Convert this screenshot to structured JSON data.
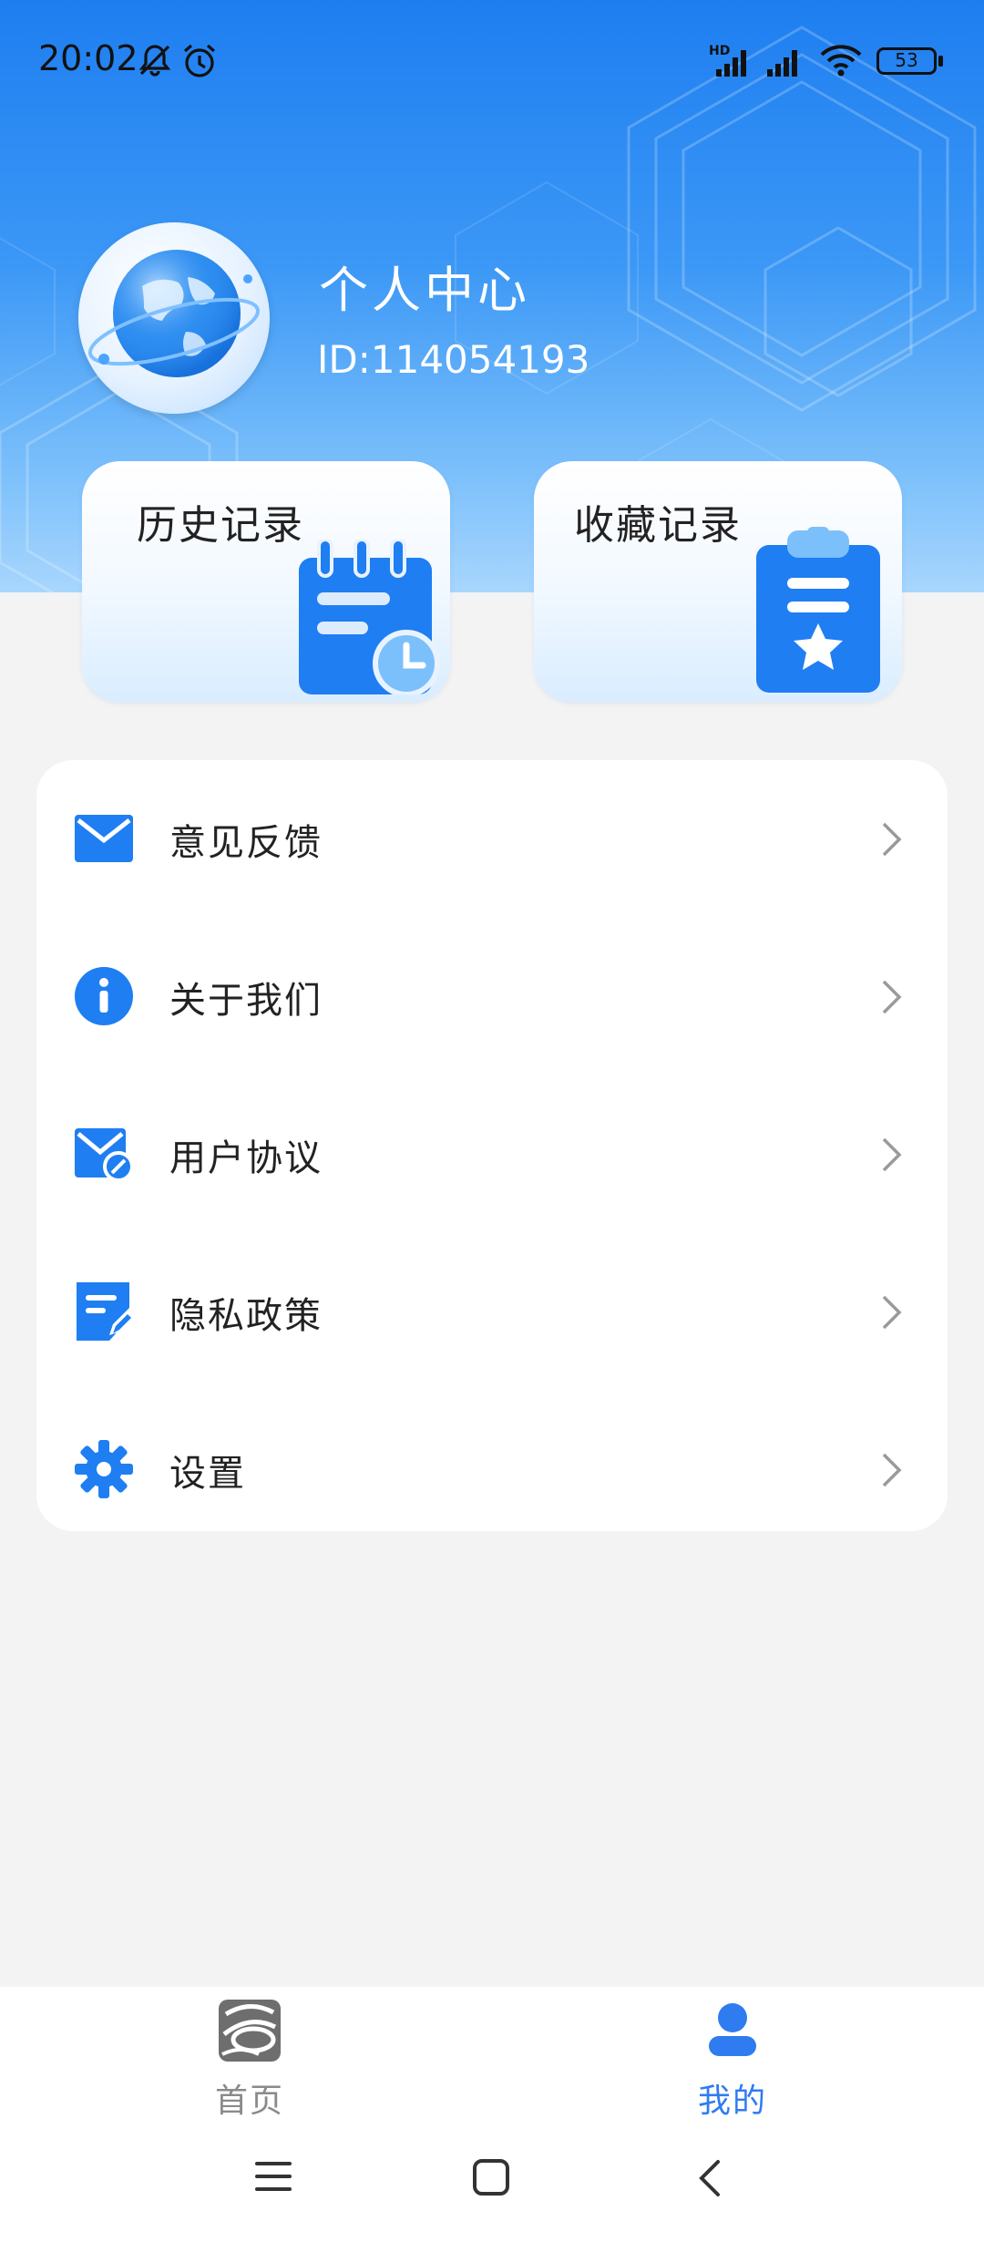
{
  "status_bar": {
    "time": "20:02",
    "battery": "53",
    "network_label": "HD"
  },
  "profile": {
    "name": "个人中心",
    "id": "ID:114054193"
  },
  "quick_cards": {
    "history": {
      "label": "历史记录",
      "icon": "calendar-clock-icon"
    },
    "favorite": {
      "label": "收藏记录",
      "icon": "clipboard-star-icon"
    }
  },
  "menu": {
    "items": [
      {
        "label": "意见反馈",
        "icon": "mail-icon"
      },
      {
        "label": "关于我们",
        "icon": "info-icon"
      },
      {
        "label": "用户协议",
        "icon": "agreement-icon"
      },
      {
        "label": "隐私政策",
        "icon": "document-edit-icon"
      },
      {
        "label": "设置",
        "icon": "gear-icon"
      }
    ]
  },
  "bottom_nav": {
    "tabs": [
      {
        "label": "首页",
        "icon": "home-logo-icon",
        "active": false
      },
      {
        "label": "我的",
        "icon": "person-icon",
        "active": true
      }
    ]
  },
  "colors": {
    "accent": "#2f7cf0",
    "icon_blue": "#1f7ef2",
    "hero_top": "#1e7ef0",
    "background": "#f3f3f3"
  }
}
